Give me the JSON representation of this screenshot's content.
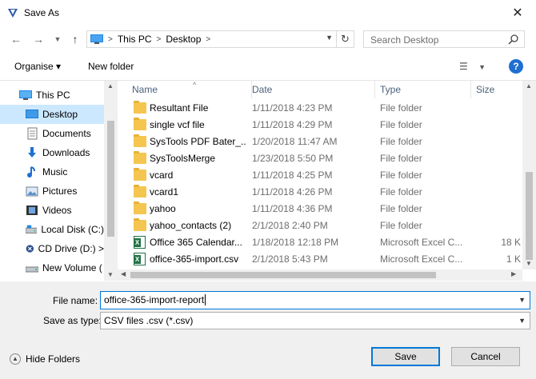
{
  "window": {
    "title": "Save As"
  },
  "address": {
    "crumbs": [
      "This PC",
      "Desktop"
    ]
  },
  "search": {
    "placeholder": "Search Desktop"
  },
  "toolbar": {
    "organise": "Organise ▾",
    "new_folder": "New folder"
  },
  "sidebar": {
    "items": [
      {
        "label": "This PC",
        "icon": "pc-icon"
      },
      {
        "label": "Desktop",
        "icon": "desktop-icon",
        "selected": true
      },
      {
        "label": "Documents",
        "icon": "documents-icon"
      },
      {
        "label": "Downloads",
        "icon": "downloads-icon"
      },
      {
        "label": "Music",
        "icon": "music-icon"
      },
      {
        "label": "Pictures",
        "icon": "pictures-icon"
      },
      {
        "label": "Videos",
        "icon": "videos-icon"
      },
      {
        "label": "Local Disk (C:)",
        "icon": "disk-icon"
      },
      {
        "label": "CD Drive (D:) >",
        "icon": "cd-drive-icon"
      },
      {
        "label": "New Volume (",
        "icon": "volume-icon"
      }
    ]
  },
  "columns": {
    "name": "Name",
    "date": "Date",
    "type": "Type",
    "size": "Size"
  },
  "files": [
    {
      "name": "Resultant File",
      "date": "1/11/2018 4:23 PM",
      "type": "File folder",
      "size": "",
      "kind": "folder"
    },
    {
      "name": "single vcf file",
      "date": "1/11/2018 4:29 PM",
      "type": "File folder",
      "size": "",
      "kind": "folder"
    },
    {
      "name": "SysTools PDF Bater_...",
      "date": "1/20/2018 11:47 AM",
      "type": "File folder",
      "size": "",
      "kind": "folder"
    },
    {
      "name": "SysToolsMerge",
      "date": "1/23/2018 5:50 PM",
      "type": "File folder",
      "size": "",
      "kind": "folder"
    },
    {
      "name": "vcard",
      "date": "1/11/2018 4:25 PM",
      "type": "File folder",
      "size": "",
      "kind": "folder"
    },
    {
      "name": "vcard1",
      "date": "1/11/2018 4:26 PM",
      "type": "File folder",
      "size": "",
      "kind": "folder"
    },
    {
      "name": "yahoo",
      "date": "1/11/2018 4:36 PM",
      "type": "File folder",
      "size": "",
      "kind": "folder"
    },
    {
      "name": "yahoo_contacts (2)",
      "date": "2/1/2018 2:40 PM",
      "type": "File folder",
      "size": "",
      "kind": "folder"
    },
    {
      "name": "Office 365 Calendar...",
      "date": "1/18/2018 12:18 PM",
      "type": "Microsoft Excel C...",
      "size": "18 K",
      "kind": "excel"
    },
    {
      "name": "office-365-import.csv",
      "date": "2/1/2018 5:43 PM",
      "type": "Microsoft Excel C...",
      "size": "1 K",
      "kind": "excel"
    }
  ],
  "form": {
    "file_name_label": "File name:",
    "file_name_value": "office-365-import-report",
    "save_as_type_label": "Save as type:",
    "save_as_type_value": "CSV files .csv (*.csv)"
  },
  "footer": {
    "hide_folders": "Hide Folders",
    "save": "Save",
    "cancel": "Cancel"
  }
}
